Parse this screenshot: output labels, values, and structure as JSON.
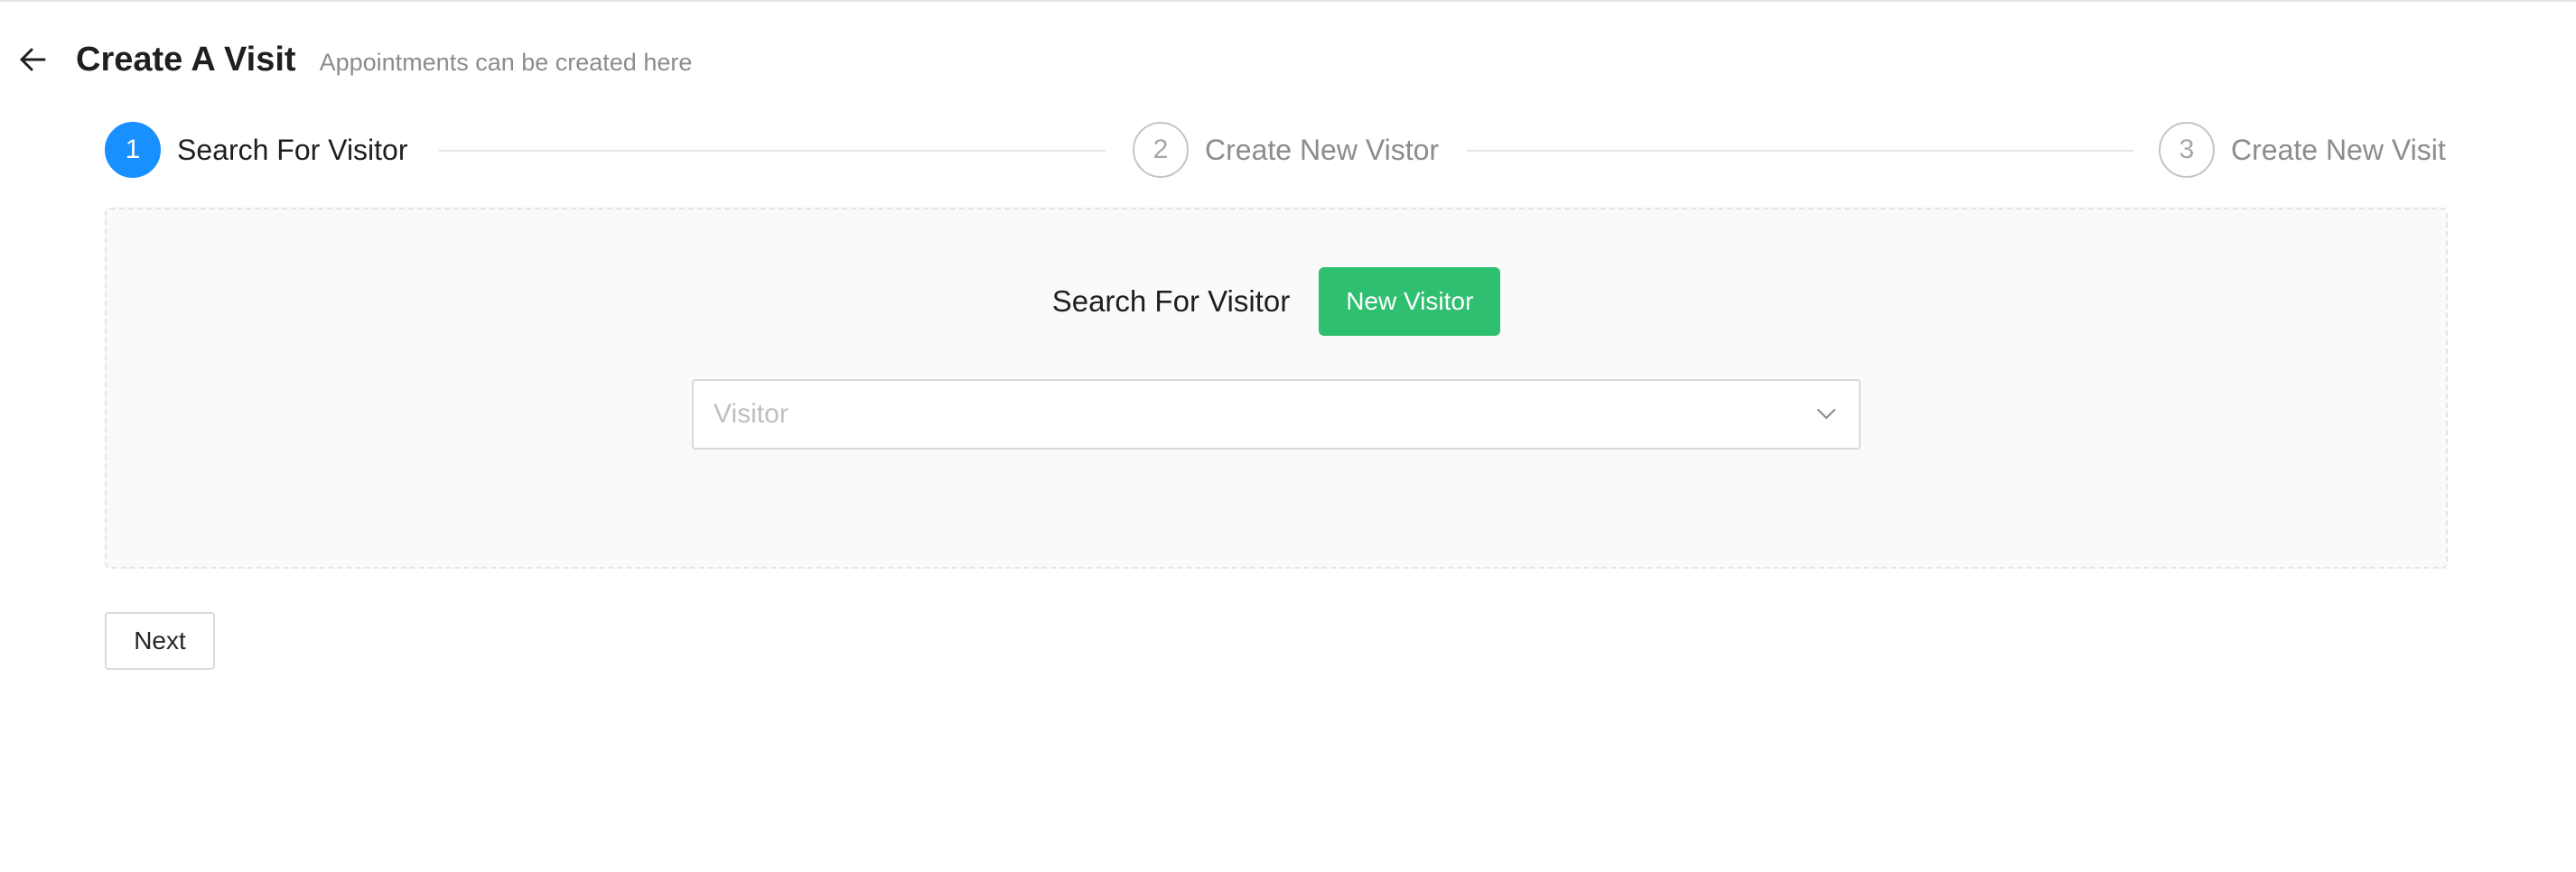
{
  "header": {
    "back_icon": "arrow-left-icon",
    "title": "Create A Visit",
    "subtitle": "Appointments can be created here"
  },
  "steps": [
    {
      "number": "1",
      "label": "Search For Visitor",
      "status": "active"
    },
    {
      "number": "2",
      "label": "Create New Vistor",
      "status": "wait"
    },
    {
      "number": "3",
      "label": "Create New Visit",
      "status": "wait"
    }
  ],
  "panel": {
    "search_label": "Search For Visitor",
    "new_visitor_button": "New Visitor",
    "visitor_select": {
      "placeholder": "Visitor",
      "value": "",
      "icon": "chevron-down-icon"
    }
  },
  "footer": {
    "next_button": "Next"
  },
  "colors": {
    "primary": "#1890ff",
    "success": "#2fbf71",
    "border": "#d9d9d9",
    "panel_bg": "#fafafa"
  }
}
